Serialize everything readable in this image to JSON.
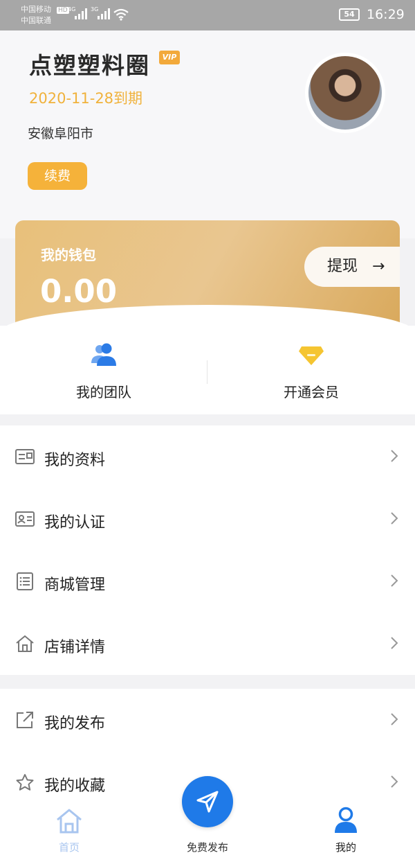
{
  "status_bar": {
    "carrier_1": "中国移动",
    "carrier_2": "中国联通",
    "hd": "HD",
    "net_1": "4G",
    "net_2": "3G",
    "battery": "54",
    "time": "16:29"
  },
  "profile": {
    "name": "点塑塑料圈",
    "vip_badge": "VIP",
    "expiry": "2020-11-28到期",
    "city": "安徽阜阳市",
    "renew_label": "续费"
  },
  "wallet": {
    "label": "我的钱包",
    "amount": "0.00",
    "withdraw_label": "提现",
    "withdraw_arrow": "→"
  },
  "quick_actions": [
    {
      "label": "我的团队",
      "icon": "team-icon"
    },
    {
      "label": "开通会员",
      "icon": "diamond-icon"
    }
  ],
  "menu_group_1": [
    {
      "label": "我的资料",
      "icon": "profile-card-icon"
    },
    {
      "label": "我的认证",
      "icon": "id-card-icon"
    },
    {
      "label": "商城管理",
      "icon": "list-icon"
    },
    {
      "label": "店铺详情",
      "icon": "store-icon"
    }
  ],
  "menu_group_2": [
    {
      "label": "我的发布",
      "icon": "share-icon"
    },
    {
      "label": "我的收藏",
      "icon": "star-icon"
    }
  ],
  "tabbar": {
    "home": "首页",
    "publish": "免费发布",
    "mine": "我的"
  },
  "colors": {
    "accent_gold": "#f5b23a",
    "tab_active": "#1f7ae8",
    "tab_inactive": "#a8c5ef"
  }
}
